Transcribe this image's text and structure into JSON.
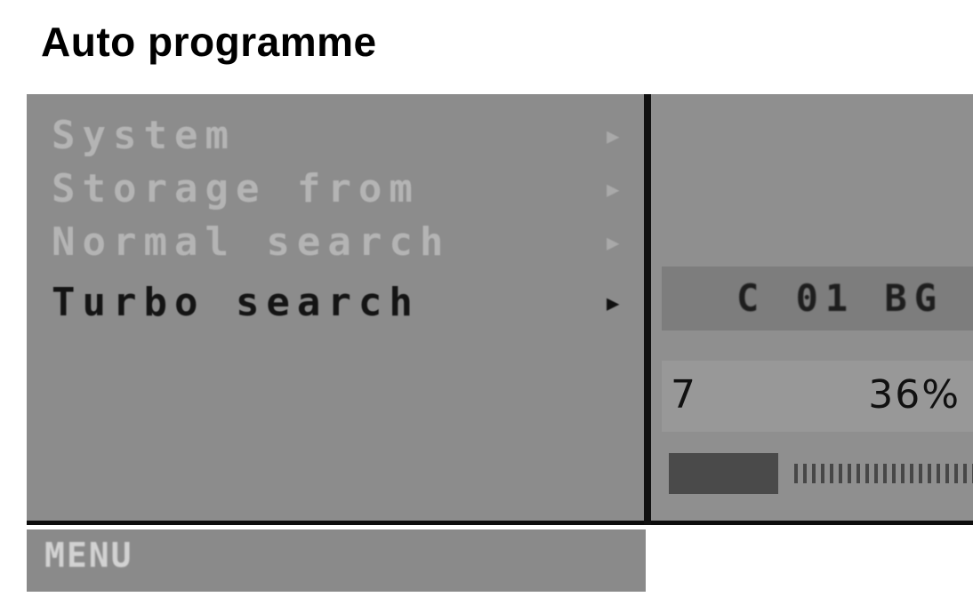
{
  "header": {
    "title": "Auto programme"
  },
  "menu": {
    "items": [
      {
        "label": "System",
        "arrow": "▶",
        "active": false
      },
      {
        "label": "Storage from",
        "arrow": "▶",
        "active": false
      },
      {
        "label": "Normal search",
        "arrow": "▶",
        "active": false
      },
      {
        "label": "Turbo search",
        "arrow": "▶",
        "active": true
      }
    ]
  },
  "status": {
    "channel_code": "C 01 BG",
    "count": "7",
    "percent": "36%",
    "progress_fraction": 0.36
  },
  "footer": {
    "menu_label": "MENU"
  },
  "colors": {
    "panel": "#8c8c8c",
    "text_inactive": "#b4b4b4",
    "text_active": "#141414",
    "progress_fill": "#4a4a4a"
  }
}
